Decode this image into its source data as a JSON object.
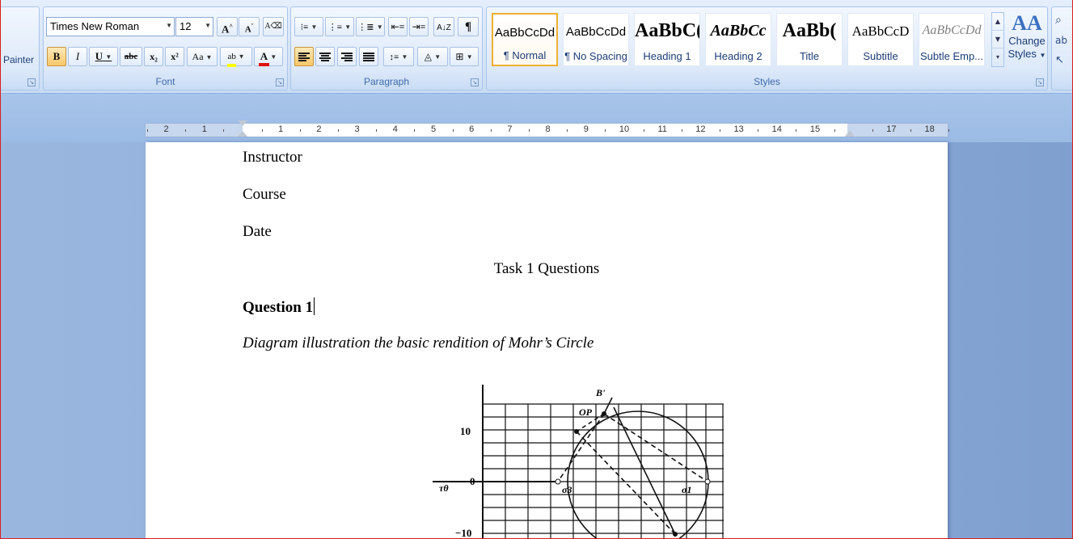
{
  "ribbon": {
    "clipboard": {
      "format_painter_label": "Painter"
    },
    "font": {
      "family": "Times New Roman",
      "size": "12",
      "group_label": "Font",
      "grow_label": "A",
      "shrink_label": "A",
      "bold_label": "B",
      "italic_label": "I",
      "underline_label": "U",
      "strike_label": "abc",
      "subscript_label": "x₂",
      "superscript_label": "x²",
      "case_label": "Aa",
      "highlight_label": "ab",
      "fontcolor_label": "A",
      "highlight_color": "#ffff00",
      "font_color": "#e01010"
    },
    "paragraph": {
      "group_label": "Paragraph",
      "show_marks_label": "¶"
    },
    "styles": {
      "group_label": "Styles",
      "items": [
        {
          "sample": "AaBbCcDd",
          "name": "¶ Normal"
        },
        {
          "sample": "AaBbCcDd",
          "name": "¶ No Spacing"
        },
        {
          "sample": "AaBbC(",
          "name": "Heading 1"
        },
        {
          "sample": "AaBbCc",
          "name": "Heading 2"
        },
        {
          "sample": "AaBb(",
          "name": "Title"
        },
        {
          "sample": "AaBbCcD",
          "name": "Subtitle"
        },
        {
          "sample": "AaBbCcDd",
          "name": "Subtle Emp..."
        }
      ],
      "change_styles_icon": "AA",
      "change_styles_line1": "Change",
      "change_styles_line2": "Styles"
    },
    "accent_selected": "#f0b030"
  },
  "ruler": {
    "labels": [
      "2",
      "1",
      "1",
      "2",
      "3",
      "4",
      "5",
      "6",
      "7",
      "8",
      "9",
      "10",
      "11",
      "12",
      "13",
      "14",
      "15",
      "17",
      "18"
    ]
  },
  "document": {
    "lines": {
      "instructor": "Instructor",
      "course": "Course",
      "date": "Date",
      "title": "Task 1 Questions",
      "question": "Question 1",
      "caption": "Diagram illustration the basic rendition of Mohr’s Circle"
    },
    "figure": {
      "y_ticks": [
        "10",
        "0",
        "−10"
      ],
      "axis_label": "τθ",
      "point_b": "B'",
      "point_op": "OP",
      "sigma3": "σ3",
      "sigma1": "σ1"
    }
  }
}
